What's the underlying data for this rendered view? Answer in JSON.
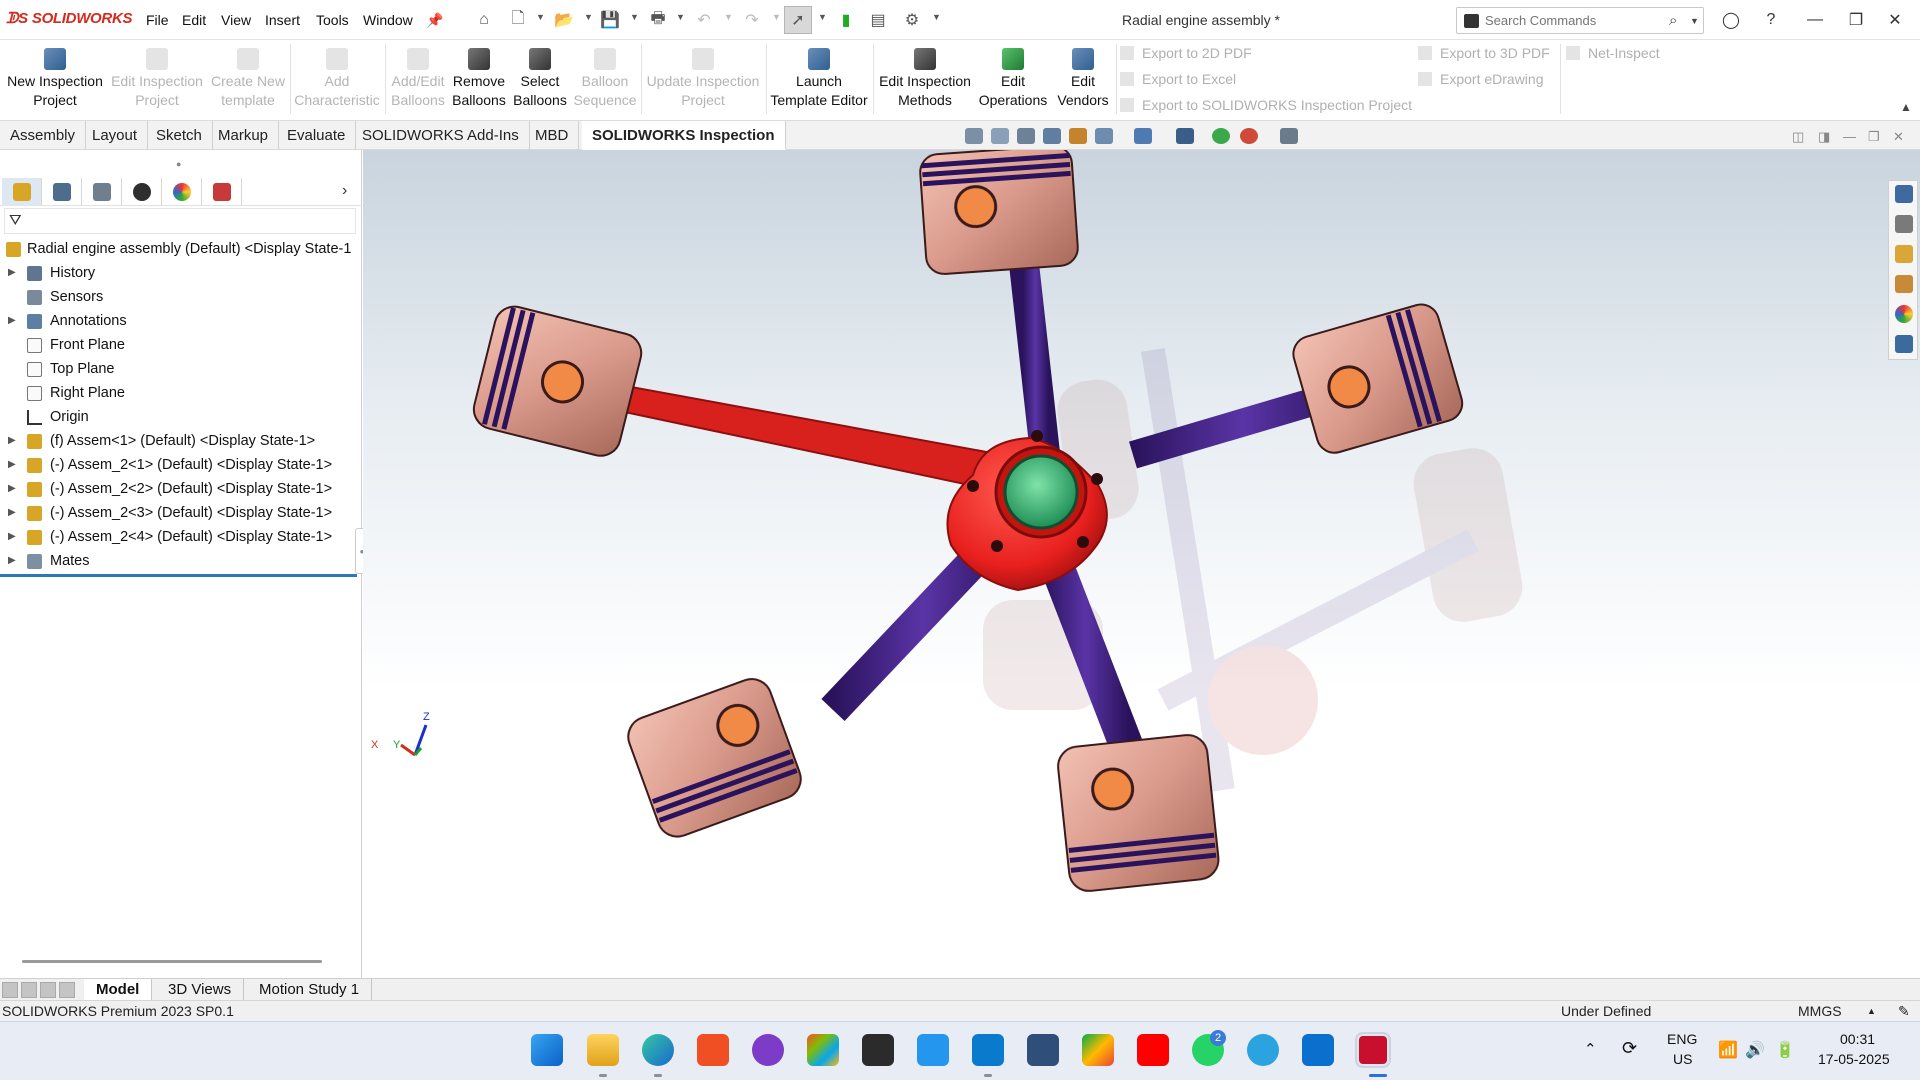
{
  "app": {
    "brand": "SOLIDWORKS",
    "document_title": "Radial engine assembly *"
  },
  "menu": [
    "File",
    "Edit",
    "View",
    "Insert",
    "Tools",
    "Window"
  ],
  "search": {
    "placeholder": "Search Commands"
  },
  "command_manager": {
    "groups": [
      {
        "label_line1": "New Inspection",
        "label_line2": "Project",
        "enabled": true
      },
      {
        "label_line1": "Edit Inspection",
        "label_line2": "Project",
        "enabled": false
      },
      {
        "label_line1": "Create New",
        "label_line2": "template",
        "enabled": false
      },
      {
        "label_line1": "Add",
        "label_line2": "Characteristic",
        "enabled": false
      },
      {
        "label_line1": "Add/Edit",
        "label_line2": "Balloons",
        "enabled": false
      },
      {
        "label_line1": "Remove",
        "label_line2": "Balloons",
        "enabled": true
      },
      {
        "label_line1": "Select",
        "label_line2": "Balloons",
        "enabled": true
      },
      {
        "label_line1": "Balloon",
        "label_line2": "Sequence",
        "enabled": false
      },
      {
        "label_line1": "Update Inspection",
        "label_line2": "Project",
        "enabled": false
      },
      {
        "label_line1": "Launch",
        "label_line2": "Template Editor",
        "enabled": true
      },
      {
        "label_line1": "Edit Inspection",
        "label_line2": "Methods",
        "enabled": true
      },
      {
        "label_line1": "Edit",
        "label_line2": "Operations",
        "enabled": true
      },
      {
        "label_line1": "Edit",
        "label_line2": "Vendors",
        "enabled": true
      }
    ],
    "export": {
      "pdf2d": "Export to 2D PDF",
      "excel": "Export to Excel",
      "sw_inspection": "Export to SOLIDWORKS Inspection Project",
      "pdf3d": "Export to 3D PDF",
      "edrawing": "Export eDrawing",
      "net_inspect": "Net-Inspect"
    }
  },
  "tabs": [
    {
      "label": "Assembly",
      "active": false
    },
    {
      "label": "Layout",
      "active": false
    },
    {
      "label": "Sketch",
      "active": false
    },
    {
      "label": "Markup",
      "active": false
    },
    {
      "label": "Evaluate",
      "active": false
    },
    {
      "label": "SOLIDWORKS Add-Ins",
      "active": false
    },
    {
      "label": "MBD",
      "active": false
    },
    {
      "label": "SOLIDWORKS Inspection",
      "active": true
    }
  ],
  "feature_tree": {
    "root": "Radial engine assembly (Default) <Display State-1",
    "items": [
      {
        "label": "History",
        "expandable": true
      },
      {
        "label": "Sensors",
        "expandable": false
      },
      {
        "label": "Annotations",
        "expandable": true
      },
      {
        "label": "Front Plane",
        "expandable": false
      },
      {
        "label": "Top Plane",
        "expandable": false
      },
      {
        "label": "Right Plane",
        "expandable": false
      },
      {
        "label": "Origin",
        "expandable": false
      },
      {
        "label": "(f) Assem<1> (Default) <Display State-1>",
        "expandable": true
      },
      {
        "label": "(-) Assem_2<1> (Default) <Display State-1>",
        "expandable": true
      },
      {
        "label": "(-) Assem_2<2> (Default) <Display State-1>",
        "expandable": true
      },
      {
        "label": "(-) Assem_2<3> (Default) <Display State-1>",
        "expandable": true
      },
      {
        "label": "(-) Assem_2<4> (Default) <Display State-1>",
        "expandable": true
      },
      {
        "label": "Mates",
        "expandable": true
      }
    ]
  },
  "triad": {
    "x": "X",
    "y": "Y",
    "z": "Z"
  },
  "bottom_tabs": [
    {
      "label": "Model",
      "active": true
    },
    {
      "label": "3D Views",
      "active": false
    },
    {
      "label": "Motion Study 1",
      "active": false
    }
  ],
  "status": {
    "version": "SOLIDWORKS Premium 2023 SP0.1",
    "state": "Under Defined",
    "units": "MMGS",
    "units_caret": "▲"
  },
  "taskbar": {
    "lang1": "ENG",
    "lang2": "US",
    "time": "00:31",
    "date": "17-05-2025",
    "whatsapp_badge": "2",
    "apps": [
      "windows-start",
      "file-explorer",
      "edge",
      "brave",
      "tor",
      "microsoft-store",
      "terminal",
      "docker",
      "vscode",
      "solidworks-tools",
      "meet",
      "youtube",
      "whatsapp",
      "telegram",
      "power-automate",
      "solidworks"
    ]
  },
  "colors": {
    "brand": "#d52b1e",
    "accent": "#2a7ab8",
    "crankcase": "#e8201e",
    "rod": "#3c1f7a",
    "piston": "#d9998a"
  }
}
